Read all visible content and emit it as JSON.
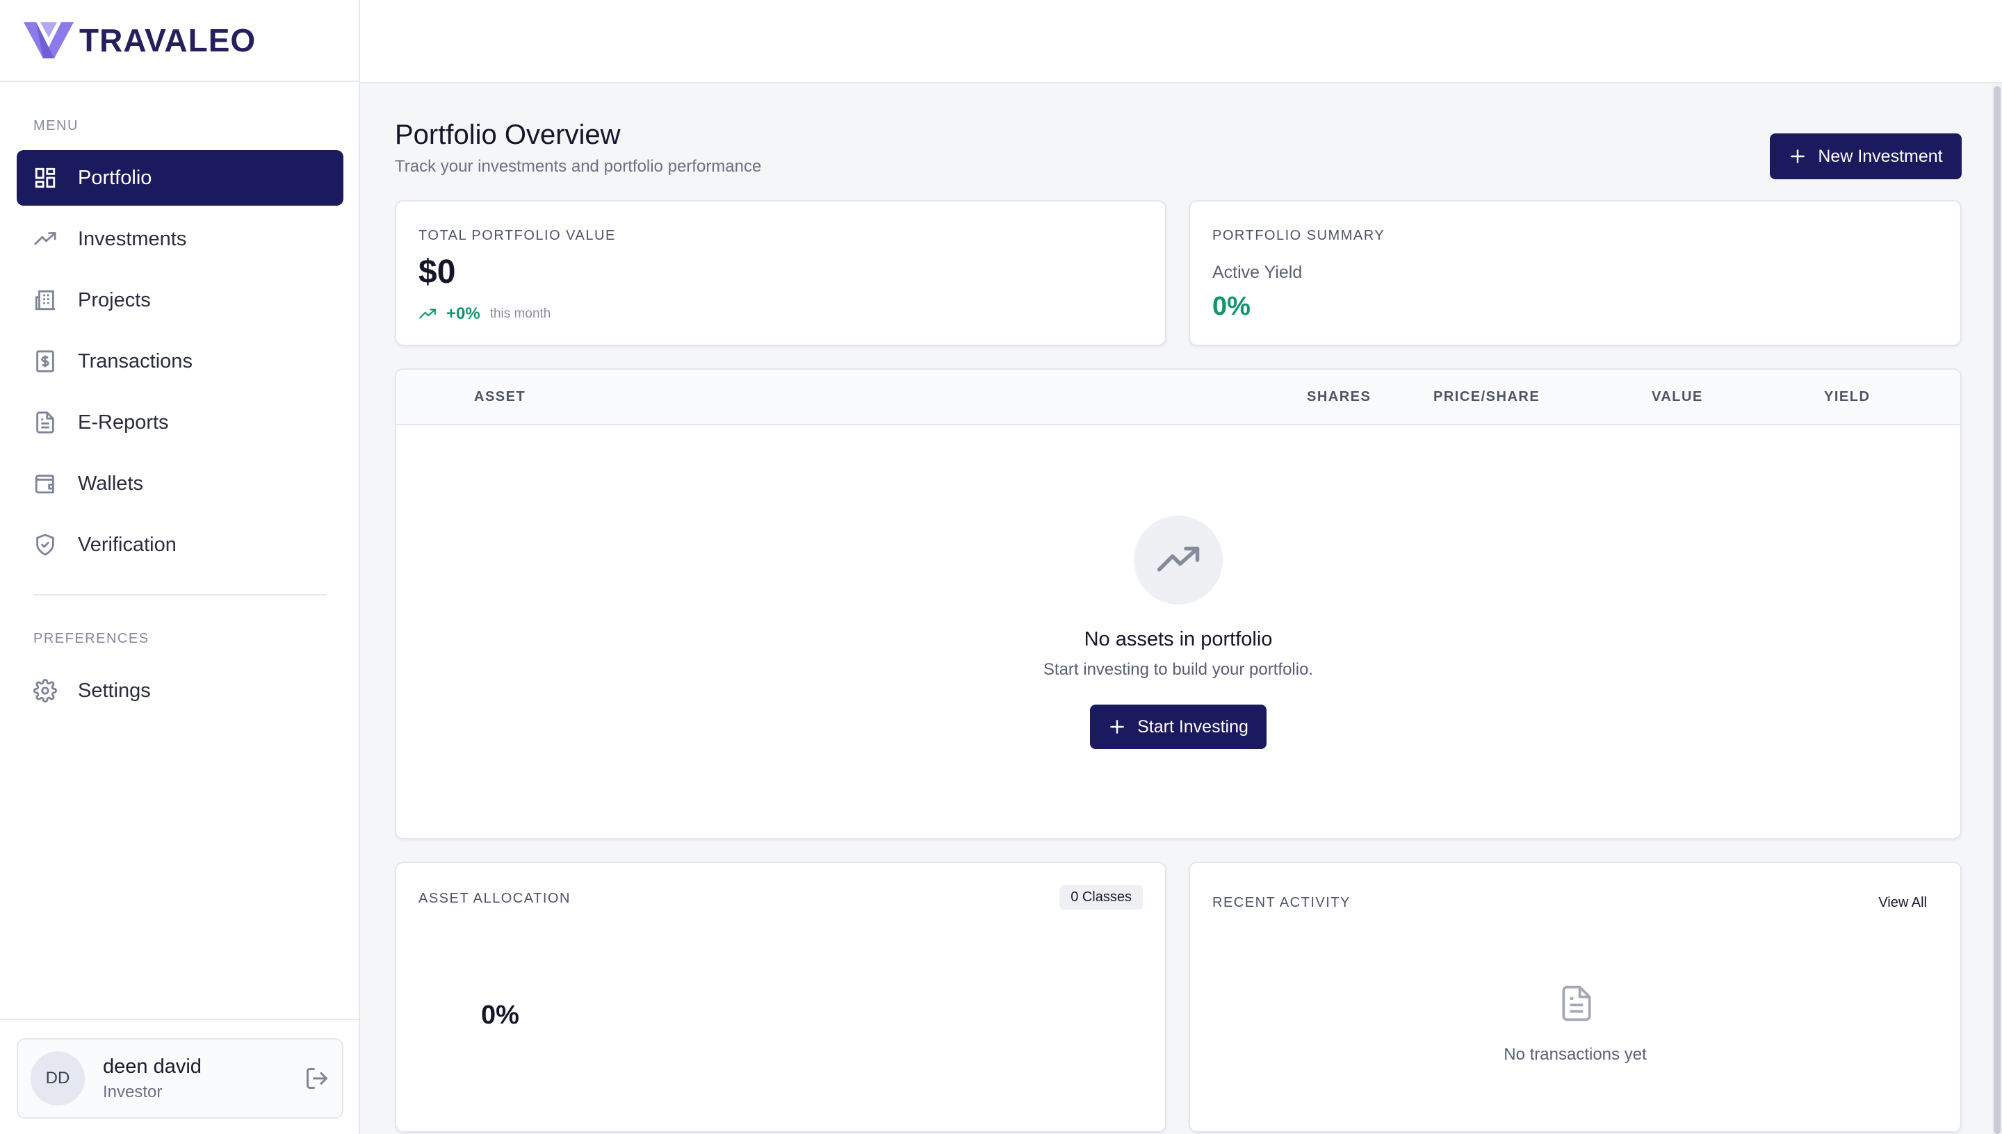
{
  "brand": {
    "name": "TRAVALEO",
    "logo": "travaleo-v-logo",
    "color": "#24205e",
    "logo_color": "#8b7be8"
  },
  "sidebar": {
    "menu_label": "MENU",
    "preferences_label": "PREFERENCES",
    "items": [
      {
        "label": "Portfolio",
        "icon": "dashboard-grid-icon",
        "active": true
      },
      {
        "label": "Investments",
        "icon": "trending-up-icon"
      },
      {
        "label": "Projects",
        "icon": "building-icon"
      },
      {
        "label": "Transactions",
        "icon": "receipt-dollar-icon"
      },
      {
        "label": "E-Reports",
        "icon": "document-icon"
      },
      {
        "label": "Wallets",
        "icon": "wallet-icon"
      },
      {
        "label": "Verification",
        "icon": "shield-check-icon"
      }
    ],
    "settings": {
      "label": "Settings",
      "icon": "gear-icon"
    },
    "user": {
      "initials": "DD",
      "name": "deen david",
      "role": "Investor",
      "logout_icon": "logout-icon"
    }
  },
  "header": {
    "title": "Portfolio Overview",
    "subtitle": "Track your investments and portfolio performance",
    "new_investment_label": "New Investment"
  },
  "total_value": {
    "label": "TOTAL PORTFOLIO VALUE",
    "value": "$0",
    "change": "+0%",
    "change_note": "this month"
  },
  "summary": {
    "label": "PORTFOLIO SUMMARY",
    "yield_label": "Active Yield",
    "yield_value": "0%"
  },
  "assets_table": {
    "columns": [
      "ASSET",
      "SHARES",
      "PRICE/SHARE",
      "VALUE",
      "YIELD"
    ],
    "empty_title": "No assets in portfolio",
    "empty_subtitle": "Start investing to build your portfolio.",
    "start_label": "Start Investing"
  },
  "allocation": {
    "label": "ASSET ALLOCATION",
    "badge": "0 Classes",
    "value": "0%"
  },
  "activity": {
    "label": "RECENT ACTIVITY",
    "view_all": "View All",
    "empty": "No transactions yet"
  },
  "colors": {
    "accent": "#1c1a5e",
    "positive": "#13956b"
  }
}
